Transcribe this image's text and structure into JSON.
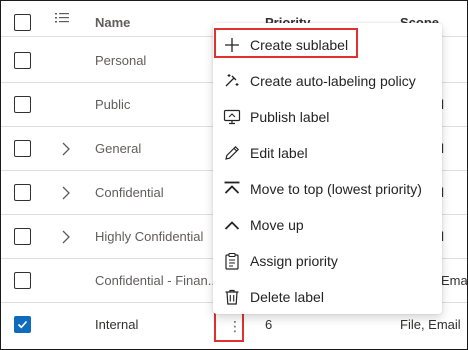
{
  "table": {
    "headers": {
      "name": "Name",
      "priority": "Priority",
      "scope": "Scope"
    },
    "rows": [
      {
        "name": "Personal",
        "priority": "",
        "scope": "",
        "expandable": false,
        "checked": false
      },
      {
        "name": "Public",
        "priority": "",
        "scope": "",
        "expandable": false,
        "checked": false
      },
      {
        "name": "General",
        "priority": "",
        "scope": "",
        "expandable": true,
        "checked": false
      },
      {
        "name": "Confidential",
        "priority": "",
        "scope": "",
        "expandable": true,
        "checked": false
      },
      {
        "name": "Highly Confidential",
        "priority": "",
        "scope": "",
        "expandable": true,
        "checked": false
      },
      {
        "name": "Confidential - Finan...",
        "priority": "",
        "scope": "",
        "expandable": false,
        "checked": false
      },
      {
        "name": "Internal",
        "priority": "6",
        "scope": "File, Email",
        "expandable": false,
        "checked": true
      }
    ]
  },
  "context_menu": {
    "items": [
      {
        "label": "Create sublabel",
        "icon": "plus-icon"
      },
      {
        "label": "Create auto-labeling policy",
        "icon": "auto-label-icon"
      },
      {
        "label": "Publish label",
        "icon": "publish-icon"
      },
      {
        "label": "Edit label",
        "icon": "pencil-icon"
      },
      {
        "label": "Move to top (lowest priority)",
        "icon": "move-to-top-icon"
      },
      {
        "label": "Move up",
        "icon": "chevron-up-icon"
      },
      {
        "label": "Assign priority",
        "icon": "clipboard-icon"
      },
      {
        "label": "Delete label",
        "icon": "trash-icon"
      }
    ]
  },
  "more_actions_glyph": "⋮",
  "colors": {
    "accent": "#0f6cbd",
    "highlight": "#e0312f"
  }
}
